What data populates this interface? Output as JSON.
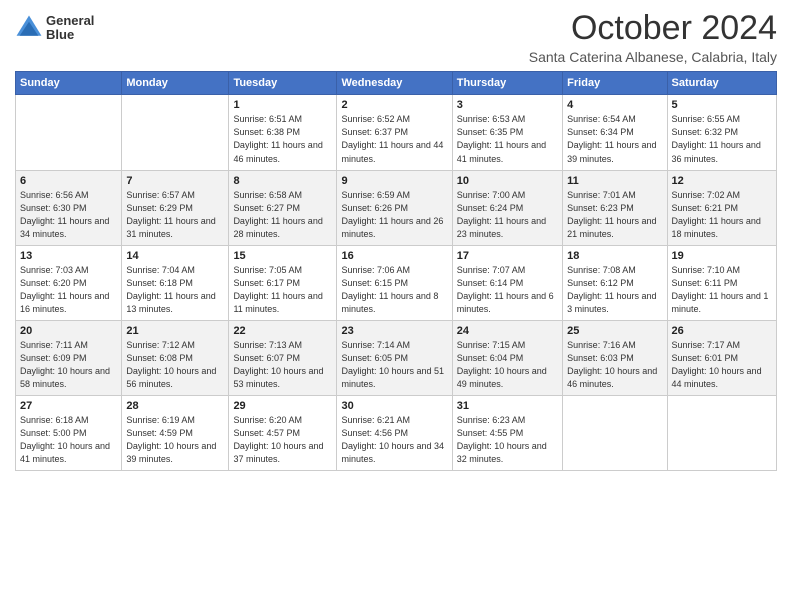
{
  "header": {
    "logo_line1": "General",
    "logo_line2": "Blue",
    "month_title": "October 2024",
    "location": "Santa Caterina Albanese, Calabria, Italy"
  },
  "days_of_week": [
    "Sunday",
    "Monday",
    "Tuesday",
    "Wednesday",
    "Thursday",
    "Friday",
    "Saturday"
  ],
  "weeks": [
    [
      {
        "num": "",
        "sunrise": "",
        "sunset": "",
        "daylight": ""
      },
      {
        "num": "",
        "sunrise": "",
        "sunset": "",
        "daylight": ""
      },
      {
        "num": "1",
        "sunrise": "6:51 AM",
        "sunset": "6:38 PM",
        "daylight": "11 hours and 46 minutes."
      },
      {
        "num": "2",
        "sunrise": "6:52 AM",
        "sunset": "6:37 PM",
        "daylight": "11 hours and 44 minutes."
      },
      {
        "num": "3",
        "sunrise": "6:53 AM",
        "sunset": "6:35 PM",
        "daylight": "11 hours and 41 minutes."
      },
      {
        "num": "4",
        "sunrise": "6:54 AM",
        "sunset": "6:34 PM",
        "daylight": "11 hours and 39 minutes."
      },
      {
        "num": "5",
        "sunrise": "6:55 AM",
        "sunset": "6:32 PM",
        "daylight": "11 hours and 36 minutes."
      }
    ],
    [
      {
        "num": "6",
        "sunrise": "6:56 AM",
        "sunset": "6:30 PM",
        "daylight": "11 hours and 34 minutes."
      },
      {
        "num": "7",
        "sunrise": "6:57 AM",
        "sunset": "6:29 PM",
        "daylight": "11 hours and 31 minutes."
      },
      {
        "num": "8",
        "sunrise": "6:58 AM",
        "sunset": "6:27 PM",
        "daylight": "11 hours and 28 minutes."
      },
      {
        "num": "9",
        "sunrise": "6:59 AM",
        "sunset": "6:26 PM",
        "daylight": "11 hours and 26 minutes."
      },
      {
        "num": "10",
        "sunrise": "7:00 AM",
        "sunset": "6:24 PM",
        "daylight": "11 hours and 23 minutes."
      },
      {
        "num": "11",
        "sunrise": "7:01 AM",
        "sunset": "6:23 PM",
        "daylight": "11 hours and 21 minutes."
      },
      {
        "num": "12",
        "sunrise": "7:02 AM",
        "sunset": "6:21 PM",
        "daylight": "11 hours and 18 minutes."
      }
    ],
    [
      {
        "num": "13",
        "sunrise": "7:03 AM",
        "sunset": "6:20 PM",
        "daylight": "11 hours and 16 minutes."
      },
      {
        "num": "14",
        "sunrise": "7:04 AM",
        "sunset": "6:18 PM",
        "daylight": "11 hours and 13 minutes."
      },
      {
        "num": "15",
        "sunrise": "7:05 AM",
        "sunset": "6:17 PM",
        "daylight": "11 hours and 11 minutes."
      },
      {
        "num": "16",
        "sunrise": "7:06 AM",
        "sunset": "6:15 PM",
        "daylight": "11 hours and 8 minutes."
      },
      {
        "num": "17",
        "sunrise": "7:07 AM",
        "sunset": "6:14 PM",
        "daylight": "11 hours and 6 minutes."
      },
      {
        "num": "18",
        "sunrise": "7:08 AM",
        "sunset": "6:12 PM",
        "daylight": "11 hours and 3 minutes."
      },
      {
        "num": "19",
        "sunrise": "7:10 AM",
        "sunset": "6:11 PM",
        "daylight": "11 hours and 1 minute."
      }
    ],
    [
      {
        "num": "20",
        "sunrise": "7:11 AM",
        "sunset": "6:09 PM",
        "daylight": "10 hours and 58 minutes."
      },
      {
        "num": "21",
        "sunrise": "7:12 AM",
        "sunset": "6:08 PM",
        "daylight": "10 hours and 56 minutes."
      },
      {
        "num": "22",
        "sunrise": "7:13 AM",
        "sunset": "6:07 PM",
        "daylight": "10 hours and 53 minutes."
      },
      {
        "num": "23",
        "sunrise": "7:14 AM",
        "sunset": "6:05 PM",
        "daylight": "10 hours and 51 minutes."
      },
      {
        "num": "24",
        "sunrise": "7:15 AM",
        "sunset": "6:04 PM",
        "daylight": "10 hours and 49 minutes."
      },
      {
        "num": "25",
        "sunrise": "7:16 AM",
        "sunset": "6:03 PM",
        "daylight": "10 hours and 46 minutes."
      },
      {
        "num": "26",
        "sunrise": "7:17 AM",
        "sunset": "6:01 PM",
        "daylight": "10 hours and 44 minutes."
      }
    ],
    [
      {
        "num": "27",
        "sunrise": "6:18 AM",
        "sunset": "5:00 PM",
        "daylight": "10 hours and 41 minutes."
      },
      {
        "num": "28",
        "sunrise": "6:19 AM",
        "sunset": "4:59 PM",
        "daylight": "10 hours and 39 minutes."
      },
      {
        "num": "29",
        "sunrise": "6:20 AM",
        "sunset": "4:57 PM",
        "daylight": "10 hours and 37 minutes."
      },
      {
        "num": "30",
        "sunrise": "6:21 AM",
        "sunset": "4:56 PM",
        "daylight": "10 hours and 34 minutes."
      },
      {
        "num": "31",
        "sunrise": "6:23 AM",
        "sunset": "4:55 PM",
        "daylight": "10 hours and 32 minutes."
      },
      {
        "num": "",
        "sunrise": "",
        "sunset": "",
        "daylight": ""
      },
      {
        "num": "",
        "sunrise": "",
        "sunset": "",
        "daylight": ""
      }
    ]
  ]
}
